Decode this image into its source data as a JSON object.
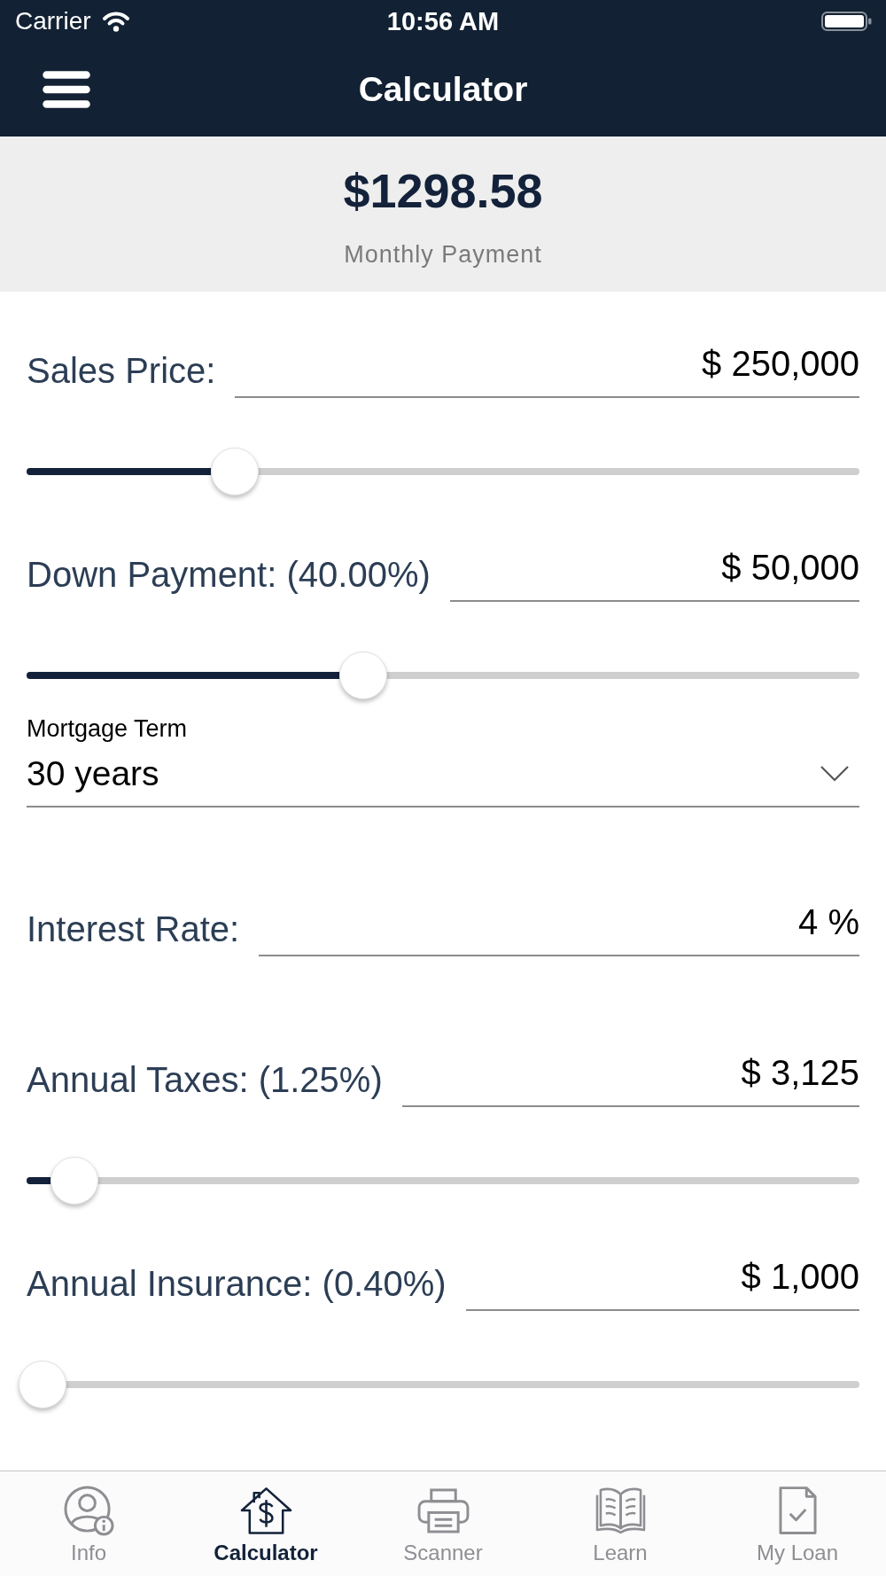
{
  "status_bar": {
    "carrier": "Carrier",
    "time": "10:56 AM"
  },
  "nav_bar": {
    "title": "Calculator"
  },
  "summary": {
    "amount": "$1298.58",
    "label": "Monthly Payment"
  },
  "fields": [
    {
      "kind": "slider_input",
      "label": "Sales Price:",
      "value": "$ 250,000",
      "level": 0.24
    },
    {
      "kind": "slider_input",
      "label": "Down Payment: (40.00%)",
      "value": "$ 50,000",
      "level": 0.4
    },
    {
      "kind": "select",
      "label": "Mortgage Term",
      "value": "30 years"
    },
    {
      "kind": "input",
      "label": "Interest Rate:",
      "value": "4 %"
    },
    {
      "kind": "slider_input",
      "label": "Annual Taxes: (1.25%)",
      "value": "$ 3,125",
      "level": 0.04
    },
    {
      "kind": "slider_input",
      "label": "Annual Insurance: (0.40%)",
      "value": "$ 1,000",
      "level": 0
    }
  ],
  "tab_bar": [
    {
      "label": "Info",
      "selected": false
    },
    {
      "label": "Calculator",
      "selected": true
    },
    {
      "label": "Scanner",
      "selected": false
    },
    {
      "label": "Learn",
      "selected": false
    },
    {
      "label": "My Loan",
      "selected": false
    }
  ]
}
